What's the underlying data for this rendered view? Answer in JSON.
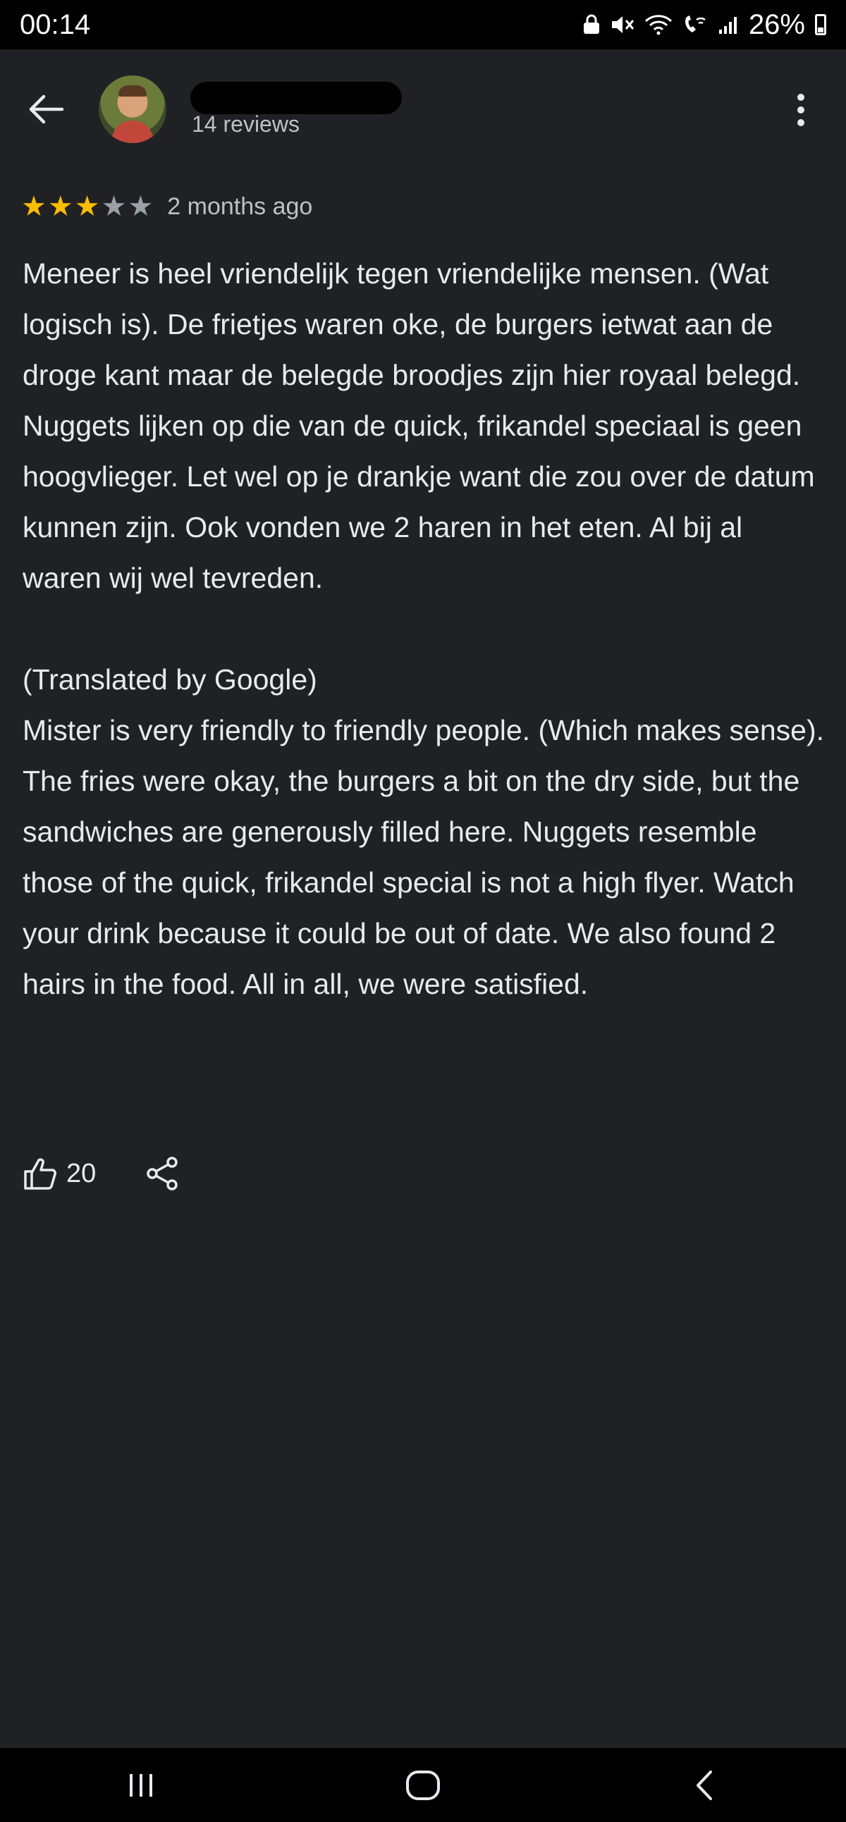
{
  "status_bar": {
    "time": "00:14",
    "battery": "26%",
    "icons": [
      "lock-icon",
      "mute-icon",
      "wifi-icon",
      "wifi-calling-icon",
      "signal-icon",
      "battery-icon"
    ]
  },
  "header": {
    "reviews_count": "14 reviews",
    "back_icon": "arrow-left-icon",
    "more_icon": "more-vertical-icon"
  },
  "review": {
    "rating": 3,
    "max_rating": 5,
    "date": "2 months ago",
    "original_text": "Meneer is heel vriendelijk tegen vriendelijke mensen. (Wat logisch is). De frietjes waren oke, de burgers ietwat aan de droge kant maar de belegde broodjes zijn hier royaal belegd. Nuggets lijken op die van de quick, frikandel speciaal is geen hoogvlieger. Let wel op je drankje want die zou over de datum kunnen zijn. Ook vonden we 2 haren in het eten. Al bij al waren wij wel tevreden.",
    "translation_label": "(Translated by Google)",
    "translated_text": "Mister is very friendly to friendly people. (Which makes sense). The fries were okay, the burgers a bit on the dry side, but the sandwiches are generously filled here. Nuggets resemble those of the quick, frikandel special is not a high flyer. Watch your drink because it could be out of date. We also found 2 hairs in the food. All in all, we were satisfied."
  },
  "actions": {
    "like_count": "20",
    "like_icon": "thumbs-up-icon",
    "share_icon": "share-icon"
  },
  "nav_bar": {
    "buttons": [
      "recent-apps-icon",
      "home-icon",
      "back-icon"
    ]
  },
  "colors": {
    "background": "#202124",
    "star_filled": "#fbbc04",
    "star_empty": "#9aa0a6",
    "text": "#e8eaed",
    "muted_text": "#bdc1c6"
  }
}
